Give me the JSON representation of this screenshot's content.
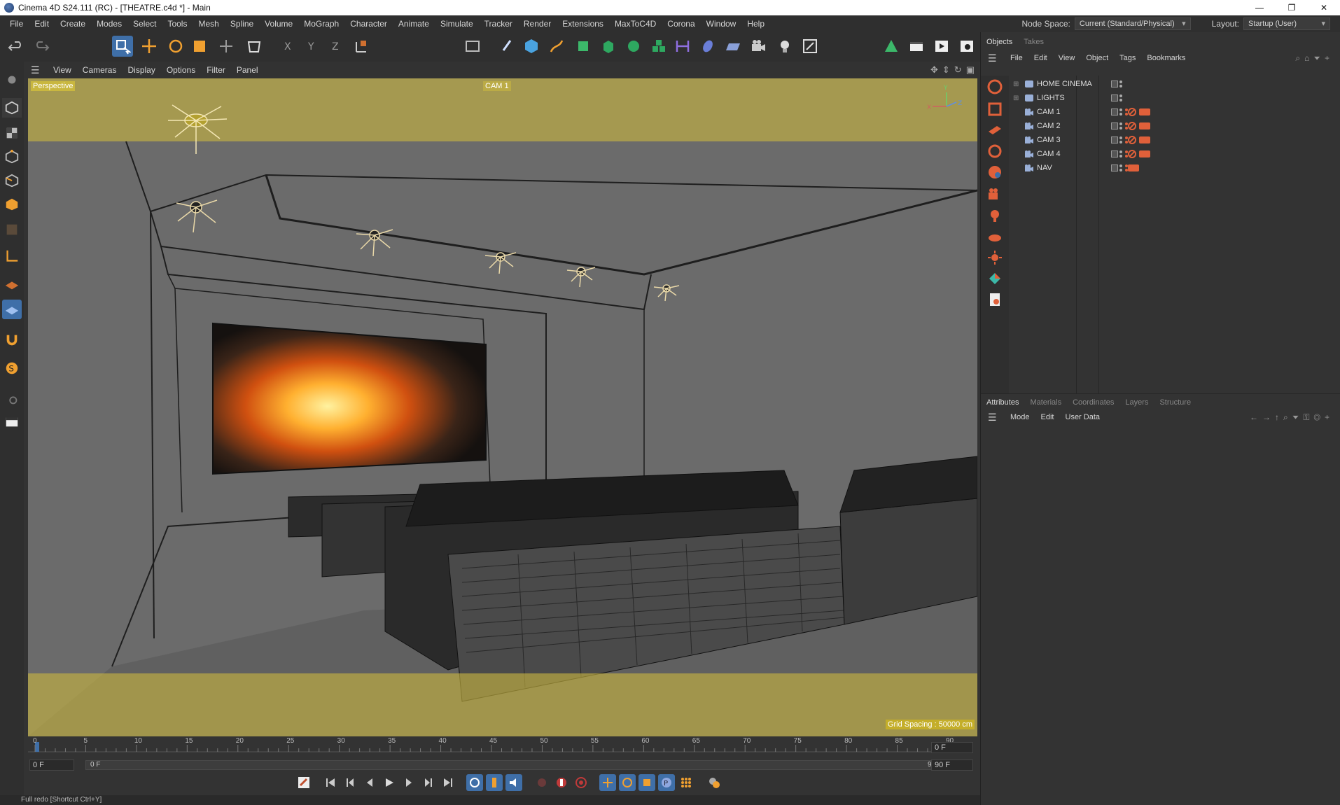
{
  "window": {
    "title": "Cinema 4D S24.111 (RC) - [THEATRE.c4d *] - Main",
    "controls": [
      "—",
      "❐",
      "✕"
    ]
  },
  "menubar": {
    "items": [
      "File",
      "Edit",
      "Create",
      "Modes",
      "Select",
      "Tools",
      "Mesh",
      "Spline",
      "Volume",
      "MoGraph",
      "Character",
      "Animate",
      "Simulate",
      "Tracker",
      "Render",
      "Extensions",
      "MaxToC4D",
      "Corona",
      "Window",
      "Help"
    ],
    "node_space_label": "Node Space:",
    "node_space_value": "Current (Standard/Physical)",
    "layout_label": "Layout:",
    "layout_value": "Startup (User)"
  },
  "viewport": {
    "menu": [
      "View",
      "Cameras",
      "Display",
      "Options",
      "Filter",
      "Panel"
    ],
    "view_name": "Perspective",
    "camera_tag": "CAM 1",
    "grid_spacing": "Grid Spacing : 50000 cm",
    "axis_labels": [
      "Y",
      "X",
      "Z"
    ]
  },
  "timeline": {
    "ticks": [
      "0",
      "5",
      "10",
      "15",
      "20",
      "25",
      "30",
      "35",
      "40",
      "45",
      "50",
      "55",
      "60",
      "65",
      "70",
      "75",
      "80",
      "85",
      "90"
    ],
    "current_frame": "0 F",
    "start_field": "0 F",
    "range_start": "0 F",
    "range_end": "90 F",
    "end_field": "90 F"
  },
  "status": {
    "text": "Full redo [Shortcut Ctrl+Y]"
  },
  "objects_panel": {
    "tabs": [
      "Objects",
      "Takes"
    ],
    "menu": [
      "File",
      "Edit",
      "View",
      "Object",
      "Tags",
      "Bookmarks"
    ],
    "rows": [
      {
        "name": "HOME CINEMA",
        "type": "layer",
        "tags": []
      },
      {
        "name": "LIGHTS",
        "type": "layer",
        "tags": []
      },
      {
        "name": "CAM 1",
        "type": "camera",
        "tags": [
          "protection",
          "camera"
        ]
      },
      {
        "name": "CAM 2",
        "type": "camera",
        "tags": [
          "protection",
          "camera"
        ]
      },
      {
        "name": "CAM 3",
        "type": "camera",
        "tags": [
          "protection",
          "camera"
        ]
      },
      {
        "name": "CAM 4",
        "type": "camera",
        "tags": [
          "protection",
          "camera"
        ]
      },
      {
        "name": "NAV",
        "type": "camera",
        "tags": [
          "camera"
        ]
      }
    ]
  },
  "attributes_panel": {
    "tabs": [
      "Attributes",
      "Materials",
      "Coordinates",
      "Layers",
      "Structure"
    ],
    "menu": [
      "Mode",
      "Edit",
      "User Data"
    ]
  },
  "colors": {
    "accent_orange": "#e0603a",
    "overlay_yellow": "#c9b740",
    "ui_bg": "#333333"
  }
}
